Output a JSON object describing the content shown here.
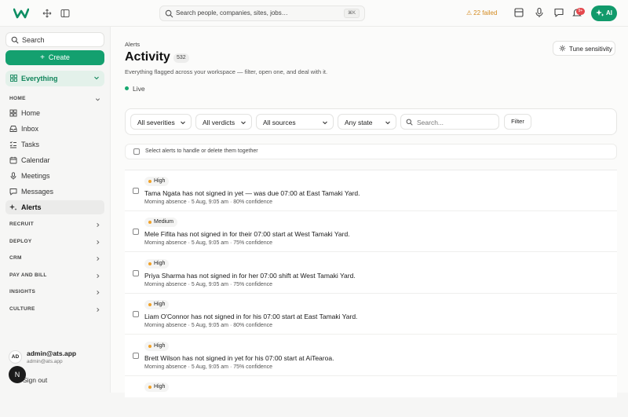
{
  "topbar": {
    "search_placeholder": "Search people, companies, sites, jobs…",
    "search_shortcut": "⌘K",
    "failed_label": "22 failed",
    "notification_badge": "9+",
    "ai_label": "AI"
  },
  "sidebar": {
    "search_label": "Search",
    "create_label": "Create",
    "workspace_label": "Everything",
    "sections": {
      "home": "HOME",
      "recruit": "RECRUIT",
      "deploy": "DEPLOY",
      "crm": "CRM",
      "pay_and_bill": "PAY AND BILL",
      "insights": "INSIGHTS",
      "culture": "CULTURE"
    },
    "items": [
      {
        "label": "Home",
        "icon": "home-icon"
      },
      {
        "label": "Inbox",
        "icon": "inbox-icon"
      },
      {
        "label": "Tasks",
        "icon": "tasks-icon"
      },
      {
        "label": "Calendar",
        "icon": "calendar-icon"
      },
      {
        "label": "Meetings",
        "icon": "microphone-icon"
      },
      {
        "label": "Messages",
        "icon": "message-icon"
      },
      {
        "label": "Alerts",
        "icon": "sparkle-icon"
      }
    ],
    "active_item": "Alerts",
    "user": {
      "initials": "AD",
      "name": "admin@ats.app",
      "email": "admin@ats.app"
    },
    "avatar_letter": "N",
    "signout_label": "Sign out"
  },
  "main": {
    "breadcrumb": "Alerts",
    "title": "Activity",
    "count": "532",
    "subtitle": "Everything flagged across your workspace — filter, open one, and deal with it.",
    "live_label": "Live",
    "tune_label": "Tune sensitivity",
    "filters": {
      "severity": "All severities",
      "verdict": "All verdicts",
      "source": "All sources",
      "state": "Any state",
      "search_placeholder": "Search...",
      "filter_button": "Filter"
    },
    "select_all_label": "Select alerts to handle or delete them together",
    "alerts": [
      {
        "severity": "High",
        "message": "Tama Ngata has not signed in yet — was due 07:00 at East Tamaki Yard.",
        "meta": "Morning absence · 5 Aug, 9:05 am · 80% confidence"
      },
      {
        "severity": "Medium",
        "message": "Mele Fifita has not signed in for their 07:00 start at West Tamaki Yard.",
        "meta": "Morning absence · 5 Aug, 9:05 am · 75% confidence"
      },
      {
        "severity": "High",
        "message": "Priya Sharma has not signed in for her 07:00 shift at West Tamaki Yard.",
        "meta": "Morning absence · 5 Aug, 9:05 am · 75% confidence"
      },
      {
        "severity": "High",
        "message": "Liam O'Connor has not signed in for his 07:00 start at East Tamaki Yard.",
        "meta": "Morning absence · 5 Aug, 9:05 am · 80% confidence"
      },
      {
        "severity": "High",
        "message": "Brett Wilson has not signed in yet for his 07:00 start at AiTearoa.",
        "meta": "Morning absence · 5 Aug, 9:05 am · 75% confidence"
      },
      {
        "severity": "High",
        "message": "",
        "meta": ""
      }
    ]
  },
  "colors": {
    "accent": "#14a06f",
    "warning": "#d38a1f",
    "severity_dot": "#f0a128",
    "badge": "#e5484d"
  }
}
